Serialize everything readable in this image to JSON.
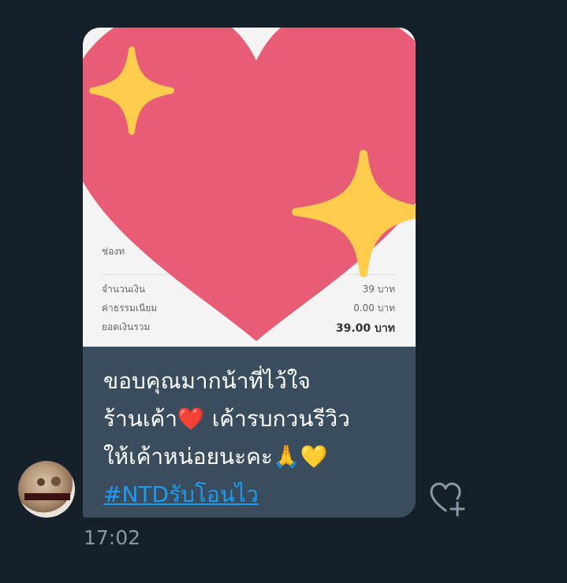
{
  "message": {
    "receipt": {
      "channel_label": "ช่องท",
      "rows": [
        {
          "label": "จำนวนเงิน",
          "value": "39 บาท"
        },
        {
          "label": "ค่าธรรมเนียม",
          "value": "0.00 บาท"
        },
        {
          "label": "ยอดเงินรวม",
          "value": "39.00 บาท"
        }
      ]
    },
    "caption_lines": [
      "ขอบคุณมากน้าที่ไว้ใจ",
      "ร้านเค้า❤️ เค้ารบกวนรีวิว",
      "ให้เค้าหน่อยนะคะ🙏💛"
    ],
    "hashtag": "#NTDรับโอนไว",
    "timestamp": "17:02"
  },
  "icons": {
    "avatar": "avatar",
    "sticker": "sparkling-heart-icon",
    "react": "add-reaction-heart-icon"
  },
  "colors": {
    "background": "#15202b",
    "bubble": "#3a4d5e",
    "heart": "#e85d75",
    "sparkle": "#ffcc4d",
    "link": "#1d9bf0",
    "timestamp": "#8b98a5"
  }
}
